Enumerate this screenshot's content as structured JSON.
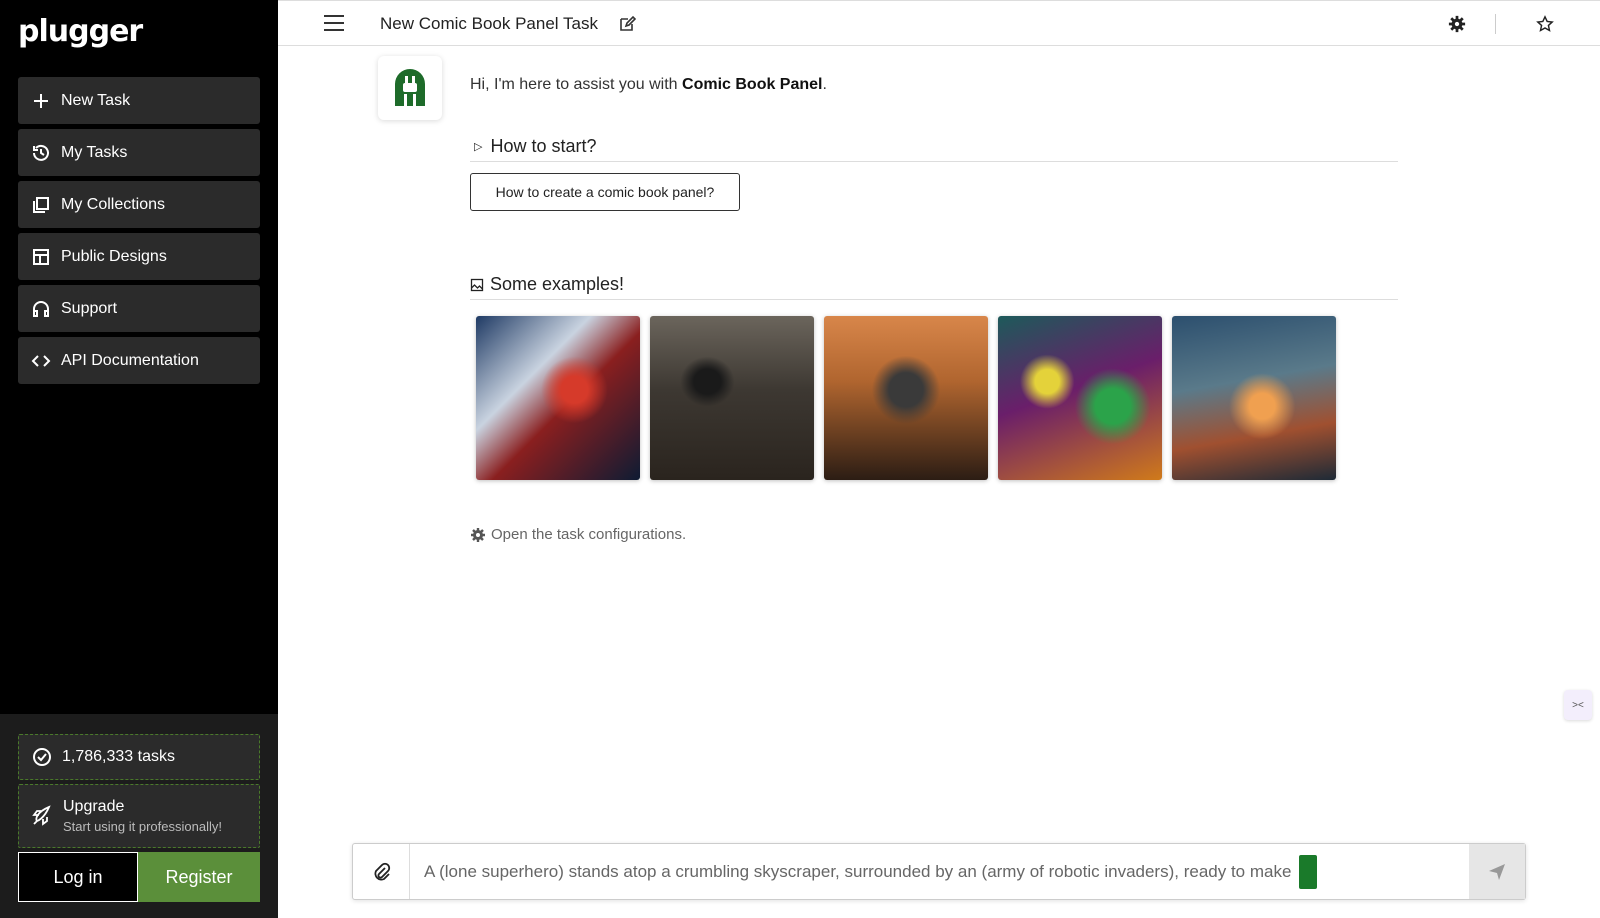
{
  "brand": {
    "name": "plugger"
  },
  "sidebar": {
    "items": [
      {
        "label": "New Task",
        "icon": "plus-icon"
      },
      {
        "label": "My Tasks",
        "icon": "history-icon"
      },
      {
        "label": "My Collections",
        "icon": "collections-icon"
      },
      {
        "label": "Public Designs",
        "icon": "layout-icon"
      },
      {
        "label": "Support",
        "icon": "headset-icon"
      },
      {
        "label": "API Documentation",
        "icon": "code-icon"
      }
    ],
    "stats": {
      "tasks": "1,786,333 tasks"
    },
    "upgrade": {
      "title": "Upgrade",
      "subtitle": "Start using it professionally!"
    },
    "auth": {
      "login": "Log in",
      "register": "Register"
    }
  },
  "header": {
    "title": "New Comic Book Panel Task"
  },
  "main": {
    "greeting_prefix": "Hi, I'm here to assist you with ",
    "greeting_topic": "Comic Book Panel",
    "greeting_suffix": ".",
    "how_to_start": "How to start?",
    "question_button": "How to create a comic book panel?",
    "examples_title": "Some examples!",
    "config_link": "Open the task configurations."
  },
  "composer": {
    "value": "A (lone superhero) stands atop a crumbling skyscraper, surrounded by an (army of robotic invaders), ready to make"
  },
  "colors": {
    "accent_green": "#5b8f3a",
    "sidebar_bg": "#000000"
  }
}
